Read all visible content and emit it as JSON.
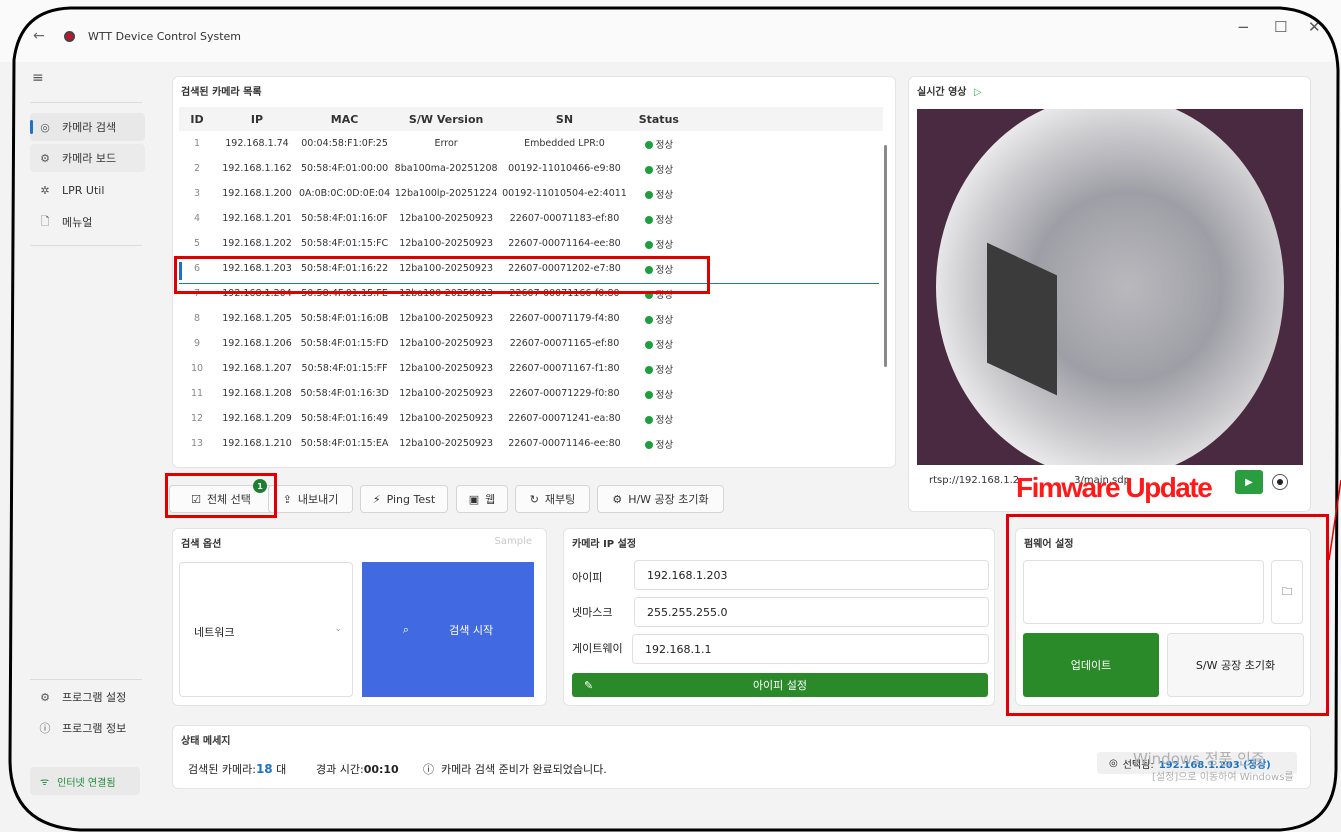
{
  "window": {
    "title": "WTT Device Control System",
    "back": "←",
    "minimize": "−",
    "maximize": "☐",
    "close": "✕"
  },
  "sidebar": {
    "menu": "≡",
    "items": [
      {
        "label": "카메라 검색",
        "icon": "camera-icon"
      },
      {
        "label": "카메라 보드",
        "icon": "gear-icon"
      },
      {
        "label": "LPR Util",
        "icon": "fan-icon"
      },
      {
        "label": "메뉴얼",
        "icon": "document-icon"
      }
    ],
    "bottom_items": [
      {
        "label": "프로그램 설정",
        "icon": "gear-icon"
      },
      {
        "label": "프로그램 정보",
        "icon": "info-icon"
      }
    ],
    "net_status": "인터넷 연결됨"
  },
  "camera_list": {
    "title": "검색된 카메라 목록",
    "columns": [
      "ID",
      "IP",
      "MAC",
      "S/W Version",
      "SN",
      "Status"
    ],
    "rows": [
      [
        "1",
        "192.168.1.74",
        "00:04:58:F1:0F:25",
        "Error",
        "Embedded LPR:0",
        "정상"
      ],
      [
        "2",
        "192.168.1.162",
        "50:58:4F:01:00:00",
        "8ba100ma-20251208",
        "00192-11010466-e9:80",
        "정상"
      ],
      [
        "3",
        "192.168.1.200",
        "0A:0B:0C:0D:0E:04",
        "12ba100lp-20251224",
        "00192-11010504-e2:4011",
        "정상"
      ],
      [
        "4",
        "192.168.1.201",
        "50:58:4F:01:16:0F",
        "12ba100-20250923",
        "22607-00071183-ef:80",
        "정상"
      ],
      [
        "5",
        "192.168.1.202",
        "50:58:4F:01:15:FC",
        "12ba100-20250923",
        "22607-00071164-ee:80",
        "정상"
      ],
      [
        "6",
        "192.168.1.203",
        "50:58:4F:01:16:22",
        "12ba100-20250923",
        "22607-00071202-e7:80",
        "정상"
      ],
      [
        "7",
        "192.168.1.204",
        "50:58:4F:01:15:FE",
        "12ba100-20250923",
        "22607-00071166-f0:80",
        "정상"
      ],
      [
        "8",
        "192.168.1.205",
        "50:58:4F:01:16:0B",
        "12ba100-20250923",
        "22607-00071179-f4:80",
        "정상"
      ],
      [
        "9",
        "192.168.1.206",
        "50:58:4F:01:15:FD",
        "12ba100-20250923",
        "22607-00071165-ef:80",
        "정상"
      ],
      [
        "10",
        "192.168.1.207",
        "50:58:4F:01:15:FF",
        "12ba100-20250923",
        "22607-00071167-f1:80",
        "정상"
      ],
      [
        "11",
        "192.168.1.208",
        "50:58:4F:01:16:3D",
        "12ba100-20250923",
        "22607-00071229-f0:80",
        "정상"
      ],
      [
        "12",
        "192.168.1.209",
        "50:58:4F:01:16:49",
        "12ba100-20250923",
        "22607-00071241-ea:80",
        "정상"
      ],
      [
        "13",
        "192.168.1.210",
        "50:58:4F:01:15:EA",
        "12ba100-20250923",
        "22607-00071146-ee:80",
        "정상"
      ]
    ],
    "selected_row": 6,
    "status_color": "#1e9e3e"
  },
  "toolbar": {
    "select_all": "전체 선택",
    "select_badge": "1",
    "export": "내보내기",
    "ping": "Ping Test",
    "web": "웹",
    "reboot": "재부팅",
    "hw_reset": "H/W 공장 초기화"
  },
  "live": {
    "title": "실시간 영상",
    "play_icon": "▷",
    "rtsp_prefix": "rtsp://192.168.1.2",
    "rtsp_suffix": "3/main.sdp",
    "play_btn": "▶"
  },
  "annotation": {
    "firmware_label": "Fimware Update"
  },
  "search_options": {
    "title": "검색 옵션",
    "sample": "Sample",
    "dropdown_value": "네트워크",
    "search_button": "검색 시작"
  },
  "ip_settings": {
    "title": "카메라 IP 설정",
    "ip_label": "아이피",
    "ip_value": "192.168.1.203",
    "mask_label": "넷마스크",
    "mask_value": "255.255.255.0",
    "gw_label": "게이트웨이",
    "gw_value": "192.168.1.1",
    "apply_button": "아이피 설정"
  },
  "firmware": {
    "title": "펌웨어 설정",
    "update_button": "업데이트",
    "sw_reset_button": "S/W 공장 초기화"
  },
  "status_bar": {
    "title": "상태 메세지",
    "cam_count_label": "검색된 카메라:",
    "cam_count": "18",
    "cam_unit": "대",
    "elapsed_label": "경과 시간:",
    "elapsed": "00:10",
    "message": "카메라 검색 준비가 완료되었습니다.",
    "selected_label": "선택됨:",
    "selected_value": "192.168.1.203 (정상)"
  },
  "watermark": {
    "line1": "Windows 정품 인증",
    "line2": "[설정]으로 이동하여 Windows를"
  },
  "colors": {
    "accent": "#1a73c8",
    "green": "#2a8a2a",
    "search_blue": "#4169e1",
    "annotation_red": "#e00000"
  }
}
